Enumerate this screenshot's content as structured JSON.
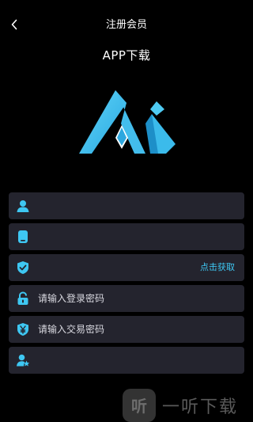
{
  "header": {
    "title": "注册会员",
    "app_title": "APP下载"
  },
  "fields": [
    {
      "id": "username",
      "icon": "user-icon",
      "placeholder": "",
      "value": ""
    },
    {
      "id": "phone",
      "icon": "phone-icon",
      "placeholder": "",
      "value": ""
    },
    {
      "id": "code",
      "icon": "shield-check-icon",
      "placeholder": "",
      "value": "",
      "action_label": "点击获取"
    },
    {
      "id": "login_password",
      "icon": "lock-icon",
      "placeholder": "请输入登录密码",
      "value": ""
    },
    {
      "id": "trade_password",
      "icon": "yen-shield-icon",
      "placeholder": "请输入交易密码",
      "value": ""
    },
    {
      "id": "invite",
      "icon": "user-star-icon",
      "placeholder": "",
      "value": ""
    }
  ],
  "colors": {
    "background": "#000000",
    "field_bg": "#24242e",
    "accent": "#3ec7f2",
    "text": "#ffffff"
  },
  "watermark": {
    "badge": "听",
    "text": "一听下载"
  }
}
